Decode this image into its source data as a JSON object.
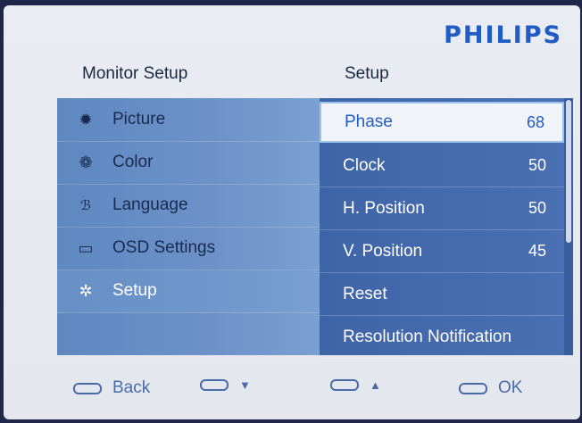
{
  "brand": "PHILIPS",
  "left_title": "Monitor Setup",
  "right_title": "Setup",
  "menu": [
    {
      "label": "Picture",
      "icon": "sun-icon"
    },
    {
      "label": "Color",
      "icon": "palette-icon"
    },
    {
      "label": "Language",
      "icon": "language-icon"
    },
    {
      "label": "OSD Settings",
      "icon": "monitor-icon"
    },
    {
      "label": "Setup",
      "icon": "gear-icon"
    }
  ],
  "submenu": [
    {
      "label": "Phase",
      "value": "68"
    },
    {
      "label": "Clock",
      "value": "50"
    },
    {
      "label": "H. Position",
      "value": "50"
    },
    {
      "label": "V. Position",
      "value": "45"
    },
    {
      "label": "Reset",
      "value": ""
    },
    {
      "label": "Resolution Notification",
      "value": ""
    }
  ],
  "footer": {
    "back": "Back",
    "down": "▼",
    "up": "▲",
    "ok": "OK"
  },
  "colors": {
    "brand": "#1f5cc4",
    "left_panel": "#6c92c8",
    "right_panel": "#4a6fb3",
    "selected_bg": "#f1f4fa"
  }
}
